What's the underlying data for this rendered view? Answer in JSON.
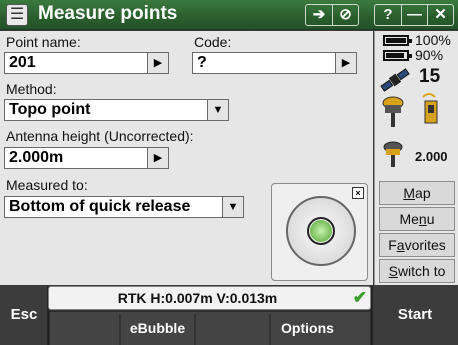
{
  "titlebar": {
    "title": "Measure points",
    "buttons": [
      "➔",
      "⊘",
      "?",
      "—",
      "✕"
    ]
  },
  "form": {
    "point_name_label": "Point name:",
    "point_name_value": "201",
    "code_label": "Code:",
    "code_value": "?",
    "method_label": "Method:",
    "method_value": "Topo point",
    "antenna_label": "Antenna height (Uncorrected):",
    "antenna_value": "2.000m",
    "measured_to_label": "Measured to:",
    "measured_to_value": "Bottom of quick release"
  },
  "status": {
    "precision": "RTK H:0.007m V:0.013m"
  },
  "right_panel": {
    "battery1_pct": "100%",
    "battery2_pct": "90%",
    "satellites": "15",
    "antenna_height": "2.000",
    "buttons": {
      "map_pre": "",
      "map_u": "M",
      "map_post": "ap",
      "menu_pre": "Me",
      "menu_u": "n",
      "menu_post": "u",
      "fav_pre": "F",
      "fav_u": "a",
      "fav_post": "vorites",
      "switch_pre": "",
      "switch_u": "S",
      "switch_post": "witch to"
    }
  },
  "softkeys": {
    "esc": "Esc",
    "ebubble": "eBubble",
    "options": "Options",
    "start": "Start"
  }
}
